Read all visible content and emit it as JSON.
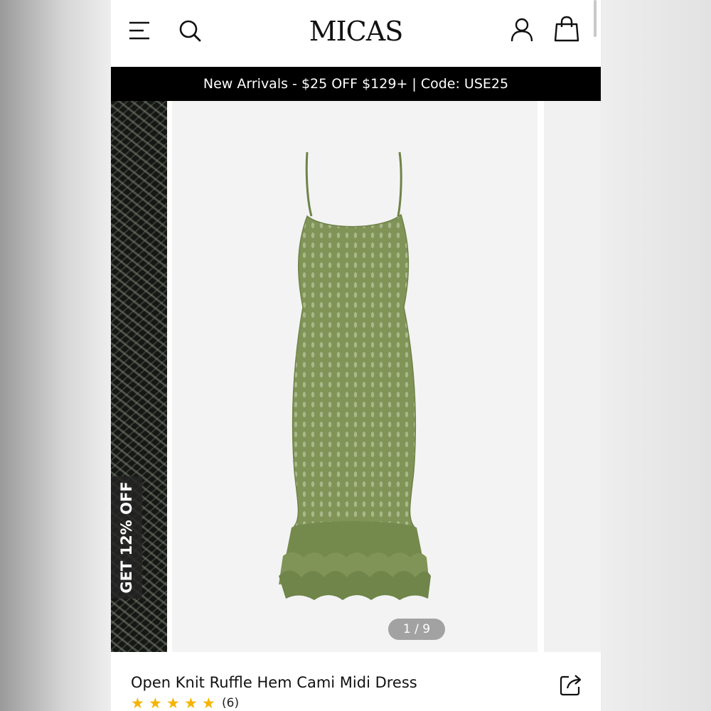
{
  "header": {
    "logo": "MICAS",
    "icons": [
      "menu-icon",
      "search-icon",
      "account-icon",
      "bag-icon"
    ]
  },
  "promo": {
    "text": "New Arrivals - $25 OFF $129+ | Code: USE25"
  },
  "side_banner": {
    "text": "GET 12% OFF"
  },
  "gallery": {
    "counter": "1 / 9",
    "zoom_icon": "zoom-icon"
  },
  "product": {
    "title": "Open Knit Ruffle Hem Cami Midi Dress",
    "rating": 5,
    "review_count": "(6)",
    "share_icon": "share-icon"
  },
  "colors": {
    "promo_bg": "#000000",
    "star": "#f5b400",
    "dress": "#7f9456",
    "counter_bg": "#a2a2a2"
  }
}
